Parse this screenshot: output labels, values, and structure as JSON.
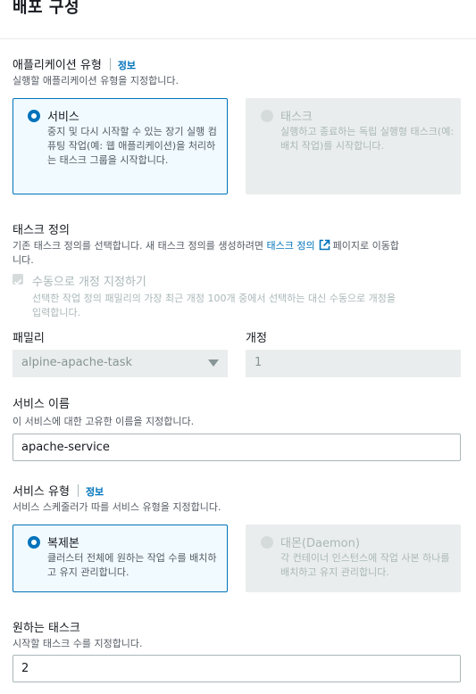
{
  "page": {
    "title": "배포 구성"
  },
  "app_type": {
    "label": "애플리케이션 유형",
    "info_link": "정보",
    "description": "실행할 애플리케이션 유형을 지정합니다.",
    "options": [
      {
        "title": "서비스",
        "description": "중지 및 다시 시작할 수 있는 장기 실행 컴퓨팅 작업(예: 웹 애플리케이션)을 처리하는 태스크 그룹을 시작합니다.",
        "selected": true,
        "disabled": false
      },
      {
        "title": "태스크",
        "description": "실행하고 종료하는 독립 실행형 태스크(예: 배치 작업)를 시작합니다.",
        "selected": false,
        "disabled": true
      }
    ]
  },
  "task_definition": {
    "label": "태스크 정의",
    "description_pre": "기존 태스크 정의를 선택합니다. 새 태스크 정의를 생성하려면",
    "link": "태스크 정의",
    "description_post": "페이지로 이동합",
    "description_wrap": "니다.",
    "manual_revision": {
      "label": "수동으로 개정 지정하기",
      "checked": true,
      "description_line1": "선택한 작업 정의 패밀리의 가장 최근 개정 100개 중에서 선택하는 대신 수동으로 개정을",
      "description_line2": "입력합니다."
    },
    "family": {
      "label": "패밀리",
      "value": "alpine-apache-task"
    },
    "revision": {
      "label": "개정",
      "value": "1"
    }
  },
  "service_name": {
    "label": "서비스 이름",
    "description": "이 서비스에 대한 고유한 이름을 지정합니다.",
    "value": "apache-service"
  },
  "service_type": {
    "label": "서비스 유형",
    "info_link": "정보",
    "description": "서비스 스케줄러가 따를 서비스 유형을 지정합니다.",
    "options": [
      {
        "title": "복제본",
        "description": "클러스터 전체에 원하는 작업 수를 배치하고 유지 관리합니다.",
        "selected": true,
        "disabled": false
      },
      {
        "title": "대몬(Daemon)",
        "description": "각 컨테이너 인스턴스에 작업 사본 하나를 배치하고 유지 관리합니다.",
        "selected": false,
        "disabled": true
      }
    ]
  },
  "desired_tasks": {
    "label": "원하는 태스크",
    "description": "시작할 태스크 수를 지정합니다.",
    "value": "2"
  },
  "colors": {
    "accent": "#0073bb",
    "disabled_bg": "#eaeded",
    "selected_bg": "#f1faff",
    "text": "#16191f",
    "muted": "#545b64"
  }
}
